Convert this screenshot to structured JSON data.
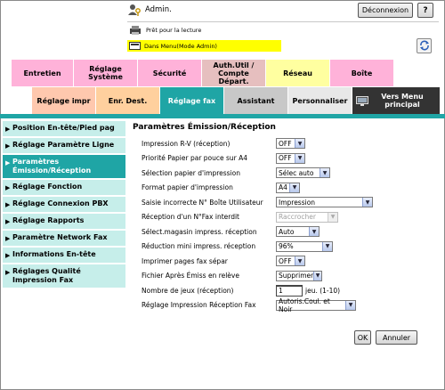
{
  "header": {
    "user_label": "Admin.",
    "logout_label": "Déconnexion",
    "help_label": "?",
    "status_text": "Prêt pour la lecture",
    "mode_text": "Dans Menu(Mode Admin)"
  },
  "top_tabs": [
    {
      "label": "Entretien",
      "color": "#ffb2d9"
    },
    {
      "label": "Réglage Système",
      "color": "#ffb2d9"
    },
    {
      "label": "Sécurité",
      "color": "#ffb2d9"
    },
    {
      "label": "Auth.Util / Compte Départ.",
      "color": "#e6bfbf"
    },
    {
      "label": "Réseau",
      "color": "#ffffa0"
    },
    {
      "label": "Boîte",
      "color": "#ffb2d9"
    }
  ],
  "sub_tabs": [
    {
      "label": "Réglage impr",
      "color": "#ffc8ae"
    },
    {
      "label": "Enr. Dest.",
      "color": "#ffd09e"
    },
    {
      "label": "Réglage fax",
      "color": "#1fa5a5"
    },
    {
      "label": "Assistant",
      "color": "#c8c8c8"
    },
    {
      "label": "Personnaliser",
      "color": "#e8e8e8"
    },
    {
      "label": "Vers Menu principal",
      "color": "#333333"
    }
  ],
  "sidebar": {
    "items": [
      {
        "label": "Position En-tête/Pied pag"
      },
      {
        "label": "Réglage Paramètre Ligne"
      },
      {
        "label": "Paramètres Émission/Réception"
      },
      {
        "label": "Réglage Fonction"
      },
      {
        "label": "Réglage Connexion PBX"
      },
      {
        "label": "Réglage Rapports"
      },
      {
        "label": "Paramètre Network Fax"
      },
      {
        "label": "Informations En-tête"
      },
      {
        "label": "Réglages Qualité Impression Fax"
      }
    ]
  },
  "main": {
    "title": "Paramètres Émission/Réception",
    "rows": [
      {
        "label": "Impression R-V (réception)",
        "value": "OFF"
      },
      {
        "label": "Priorité Papier par pouce sur A4",
        "value": "OFF"
      },
      {
        "label": "Sélection papier d'impression",
        "value": "Sélec auto"
      },
      {
        "label": "Format papier d'impression",
        "value": "A4"
      },
      {
        "label": "Saisie incorrecte N° Boîte Utilisateur",
        "value": "Impression"
      },
      {
        "label": "Réception d'un N°Fax interdit",
        "value": "Raccrocher"
      },
      {
        "label": "Sélect.magasin impress. réception",
        "value": "Auto"
      },
      {
        "label": "Réduction mini impress. réception",
        "value": "96%"
      },
      {
        "label": "Imprimer pages fax sépar",
        "value": "OFF"
      },
      {
        "label": "Fichier Après Émiss en relève",
        "value": "Supprimer"
      },
      {
        "label": "Nombre de jeux (réception)",
        "value": "1",
        "suffix": "jeu. (1-10)"
      },
      {
        "label": "Réglage Impression Réception Fax",
        "value": "Autoris.Coul. et Noir"
      }
    ]
  },
  "actions": {
    "ok_label": "OK",
    "cancel_label": "Annuler"
  }
}
